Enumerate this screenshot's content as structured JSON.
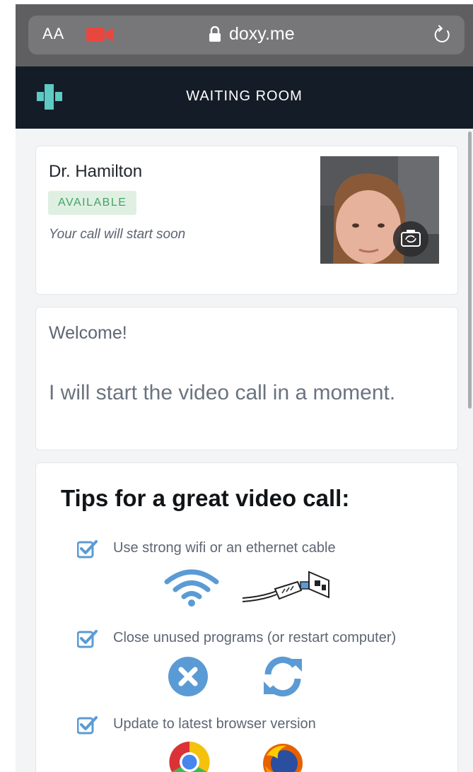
{
  "browser": {
    "text_size_label": "AA",
    "domain": "doxy.me"
  },
  "header": {
    "title": "WAITING ROOM"
  },
  "provider_card": {
    "name": "Dr. Hamilton",
    "status": "AVAILABLE",
    "message": "Your call will start soon"
  },
  "welcome_card": {
    "title": "Welcome!",
    "body": "I will start the video call in a moment."
  },
  "tips_card": {
    "title": "Tips for a great video call:",
    "tips": [
      {
        "label": "Use strong wifi or an ethernet cable",
        "icons": [
          "wifi-icon",
          "ethernet-cable-icon"
        ]
      },
      {
        "label": "Close unused programs (or restart computer)",
        "icons": [
          "close-circle-icon",
          "restart-icon"
        ]
      },
      {
        "label": "Update to latest browser version",
        "icons": [
          "chrome-icon",
          "firefox-icon"
        ]
      }
    ]
  },
  "colors": {
    "browser_chrome": "#5f5f62",
    "app_header": "#141d27",
    "available_badge_bg": "#dff0e3",
    "available_badge_text": "#44a264",
    "tip_blue": "#5b9bd5",
    "logo_teal": "#5fc9c4"
  }
}
